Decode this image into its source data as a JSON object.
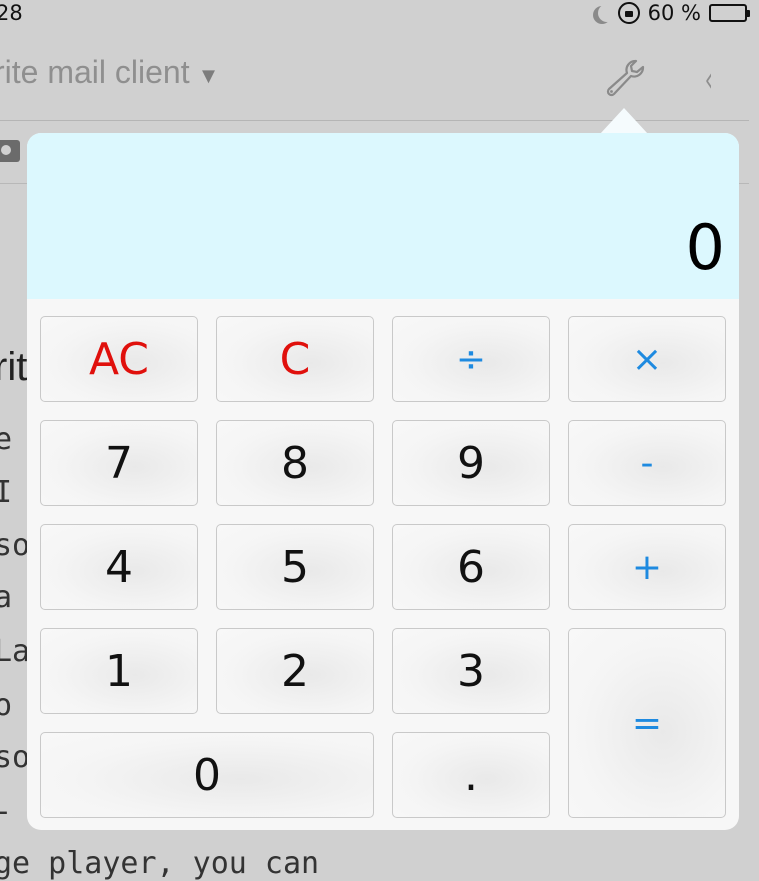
{
  "status_bar": {
    "time": "28",
    "battery_percent": "60 %",
    "battery_level": 0.6
  },
  "nav": {
    "title": "rite mail client",
    "caret": "▼",
    "back": "‹"
  },
  "background": {
    "heading_fragment": "rit",
    "text_lines": [
      "e",
      "I",
      "so",
      "a",
      "La",
      "o",
      "so",
      "- ",
      "ge player, you can"
    ]
  },
  "calculator": {
    "display": "0",
    "keys": {
      "ac": "AC",
      "c": "C",
      "divide": "÷",
      "multiply": "×",
      "seven": "7",
      "eight": "8",
      "nine": "9",
      "minus": "-",
      "four": "4",
      "five": "5",
      "six": "6",
      "plus": "+",
      "one": "1",
      "two": "2",
      "three": "3",
      "equals": "=",
      "zero": "0",
      "decimal": "."
    }
  },
  "colors": {
    "display_bg": "#dcf8fe",
    "clear_key": "#e0100c",
    "operator_key": "#1e8ae0"
  }
}
